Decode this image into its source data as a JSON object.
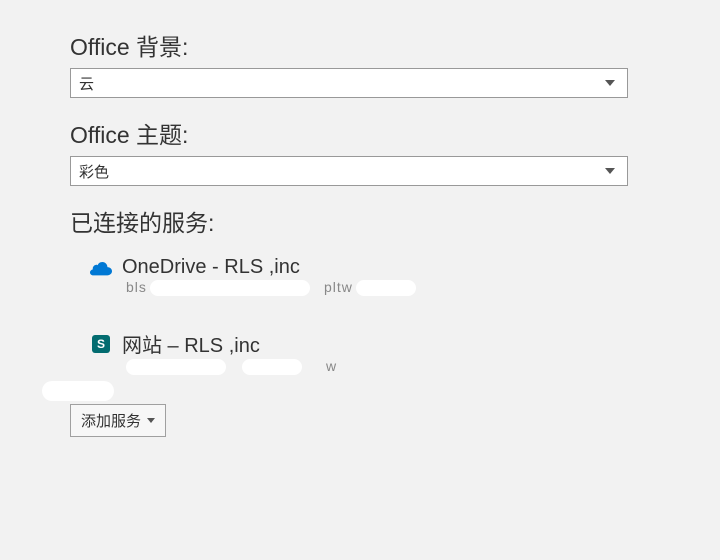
{
  "background_section": {
    "label": "Office 背景:",
    "value": "云"
  },
  "theme_section": {
    "label": "Office 主题:",
    "value": "彩色"
  },
  "services_section": {
    "label": "已连接的服务:",
    "items": [
      {
        "icon": "onedrive",
        "title": "OneDrive - RLS ,inc",
        "subtext_fragments": {
          "left": "bls",
          "right": "pltw"
        }
      },
      {
        "icon": "sharepoint",
        "icon_letter": "S",
        "title": "网站 – RLS ,inc",
        "subtext_fragments": {
          "right": "w"
        }
      }
    ]
  },
  "add_service_button": {
    "label": "添加服务"
  }
}
